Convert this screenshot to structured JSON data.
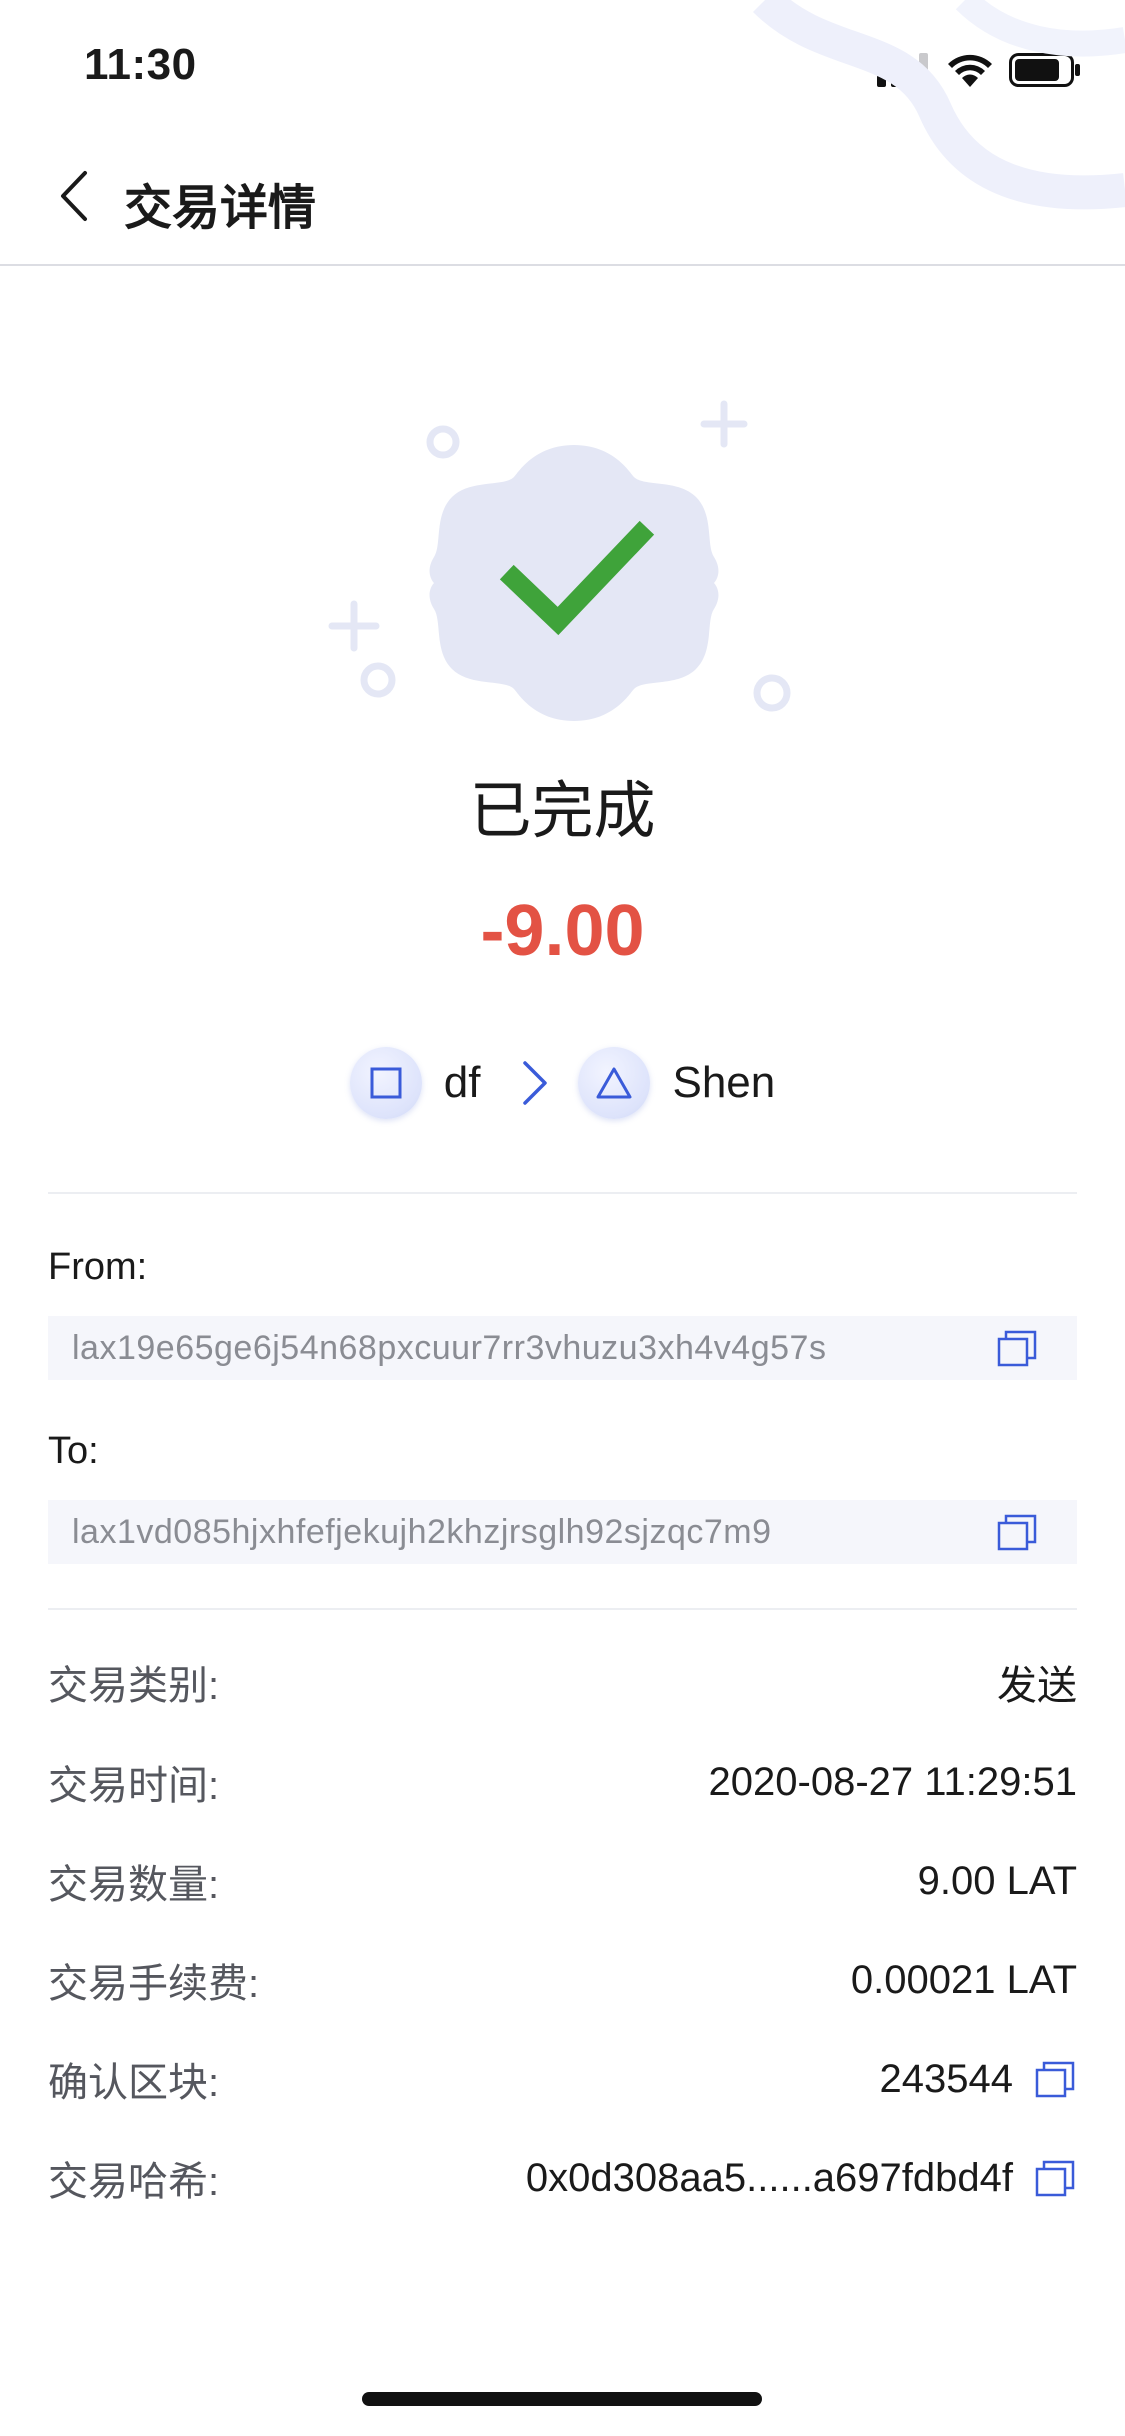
{
  "status_bar": {
    "time": "11:30"
  },
  "header": {
    "title": "交易详情",
    "back_icon": "chevron-left-icon"
  },
  "transaction": {
    "status": "已完成",
    "amount": "-9.00",
    "amount_color": "#e35244",
    "from_wallet": {
      "name": "df",
      "icon": "square-icon"
    },
    "to_wallet": {
      "name": "Shen",
      "icon": "triangle-icon"
    }
  },
  "addresses": {
    "from_label": "From:",
    "from_address": "lax19e65ge6j54n68pxcuur7rr3vhuzu3xh4v4g57s",
    "to_label": "To:",
    "to_address": "lax1vd085hjxhfefjekujh2khzjrsglh92sjzqc7m9"
  },
  "details": [
    {
      "label": "交易类别:",
      "value": "发送"
    },
    {
      "label": "交易时间:",
      "value": "2020-08-27 11:29:51"
    },
    {
      "label": "交易数量:",
      "value": "9.00 LAT"
    },
    {
      "label": "交易手续费:",
      "value": "0.00021 LAT"
    },
    {
      "label": "确认区块:",
      "value": "243544"
    },
    {
      "label": "交易哈希:",
      "value": "0x0d308aa5......a697fdbd4f"
    }
  ],
  "colors": {
    "accent_blue": "#3a5bd9",
    "success_green": "#3fa33a",
    "badge_bg": "#e4e7f5"
  }
}
